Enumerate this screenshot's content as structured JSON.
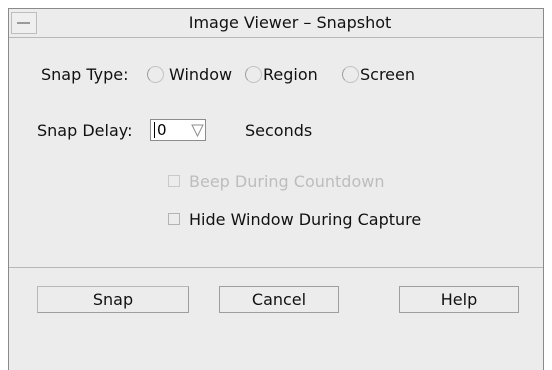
{
  "window": {
    "title": "Image Viewer – Snapshot"
  },
  "snap_type": {
    "label": "Snap Type:",
    "options": [
      {
        "label": "Window",
        "selected": true
      },
      {
        "label": "Region",
        "selected": false
      },
      {
        "label": "Screen",
        "selected": false
      }
    ]
  },
  "snap_delay": {
    "label": "Snap Delay:",
    "value": "0",
    "unit": "Seconds"
  },
  "options": {
    "beep_label": "Beep During Countdown",
    "beep_enabled": false,
    "hide_label": "Hide Window During Capture",
    "hide_checked": false
  },
  "buttons": {
    "snap": "Snap",
    "cancel": "Cancel",
    "help": "Help"
  },
  "icons": {
    "window_menu": "window-menu-icon",
    "spin": "spin-down-icon"
  },
  "colors": {
    "background": "#ececec",
    "disabled_text": "#bdbdbd"
  }
}
